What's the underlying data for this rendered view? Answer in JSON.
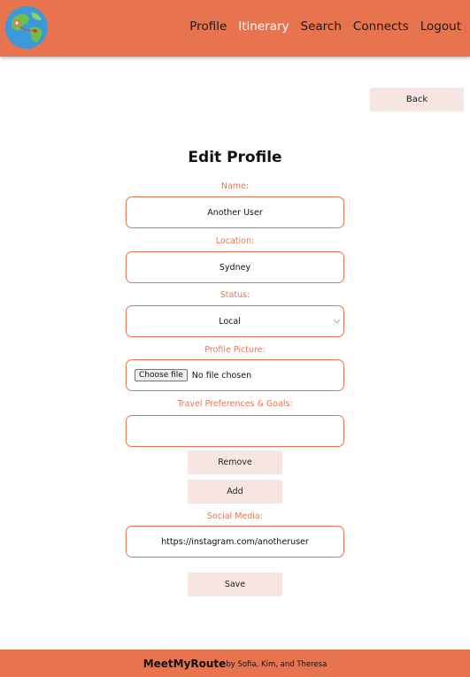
{
  "nav": {
    "logo_icon": "globe-icon",
    "items": [
      "Profile",
      "Itinerary",
      "Search",
      "Connects",
      "Logout"
    ],
    "active": "Itinerary"
  },
  "back_label": "Back",
  "form": {
    "title": "Edit Profile",
    "name_label": "Name:",
    "name_value": "Another User",
    "location_label": "Location:",
    "location_value": "Sydney",
    "status_label": "Status:",
    "status_value": "Local",
    "picture_label": "Profile Picture:",
    "file_button": "Choose file",
    "file_status": "No file chosen",
    "prefs_label": "Travel Preferences & Goals:",
    "prefs_value": "",
    "remove_label": "Remove",
    "add_label": "Add",
    "social_label": "Social Media:",
    "social_value": "https://instagram.com/anotheruser",
    "save_label": "Save"
  },
  "footer": {
    "brand": "MeetMyRoute",
    "credits": "by Sofia, Kim, and Theresa"
  },
  "colors": {
    "accent": "#e8744f",
    "button_bg": "#f6e5e1"
  }
}
